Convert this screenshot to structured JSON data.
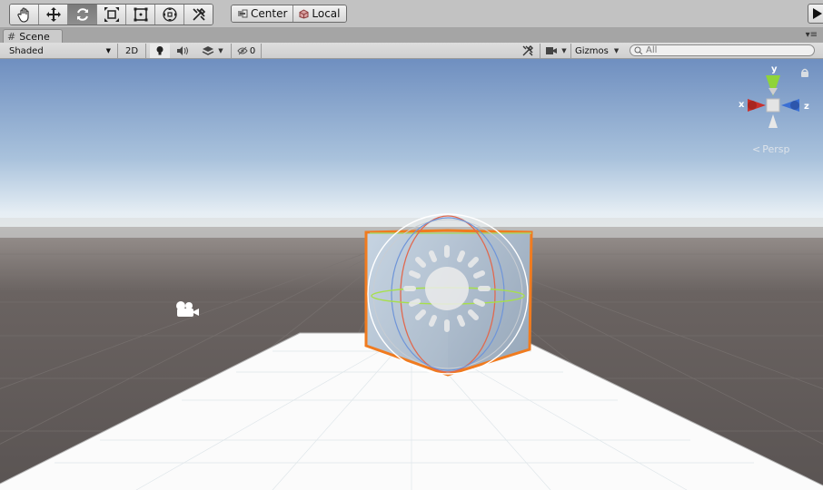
{
  "toolbar": {
    "tools": [
      {
        "name": "hand-tool",
        "icon": "hand-icon"
      },
      {
        "name": "move-tool",
        "icon": "move-icon"
      },
      {
        "name": "rotate-tool",
        "icon": "rotate-icon",
        "active": true
      },
      {
        "name": "scale-tool",
        "icon": "scale-icon"
      },
      {
        "name": "rect-tool",
        "icon": "rect-icon"
      },
      {
        "name": "transform-tool",
        "icon": "transform-icon"
      },
      {
        "name": "custom-tool",
        "icon": "custom-tool-icon"
      }
    ],
    "pivot_label": "Center",
    "rotation_label": "Local"
  },
  "tab": {
    "label": "Scene",
    "icon": "scene-hash-icon"
  },
  "scene_toolbar": {
    "draw_mode": "Shaded",
    "mode_2d": "2D",
    "hidden_count": "0",
    "gizmos_label": "Gizmos",
    "search_placeholder": "All"
  },
  "gizmo": {
    "x_label": "x",
    "y_label": "y",
    "z_label": "z",
    "projection": "Persp"
  },
  "colors": {
    "x_axis": "#c9302c",
    "y_axis": "#8fd43a",
    "z_axis": "#3a6fd4",
    "selection_outline": "#f07b1f",
    "sky_top": "#6f8fc0",
    "ground": "#5c5654"
  }
}
